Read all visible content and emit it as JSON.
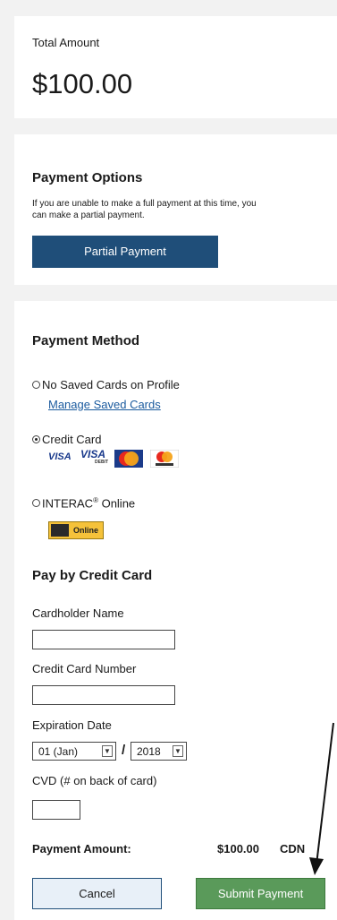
{
  "total": {
    "label": "Total Amount",
    "amount": "$100.00"
  },
  "options": {
    "title": "Payment Options",
    "desc_line1": "If you are unable to make a full payment at this time, you",
    "desc_line2": "can make a partial payment.",
    "partial_button": "Partial Payment"
  },
  "method": {
    "title": "Payment Method",
    "no_saved": "No Saved Cards on Profile",
    "manage_link": "Manage Saved Cards",
    "credit_card": "Credit Card",
    "interac": "INTERAC",
    "interac_reg": "®",
    "interac_suffix": " Online",
    "visa1": "VISA",
    "visa2": "VISA",
    "visa2_sub": "DEBIT",
    "interac_badge": "Online",
    "selected": "credit_card"
  },
  "credit": {
    "title": "Pay by Credit Card",
    "cardholder_label": "Cardholder Name",
    "card_number_label": "Credit Card Number",
    "expiration_label": "Expiration Date",
    "month_value": "01 (Jan)",
    "year_value": "2018",
    "slash": "/",
    "cvd_label": "CVD (# on back of card)"
  },
  "payment": {
    "amount_label": "Payment Amount:",
    "amount_value": "$100.00",
    "currency": "CDN",
    "cancel_button": "Cancel",
    "submit_button": "Submit Payment"
  },
  "colors": {
    "primary": "#1f4e79",
    "submit": "#5a9a5a",
    "cancel_bg": "#e8f0f8",
    "link": "#1a5a9e"
  }
}
